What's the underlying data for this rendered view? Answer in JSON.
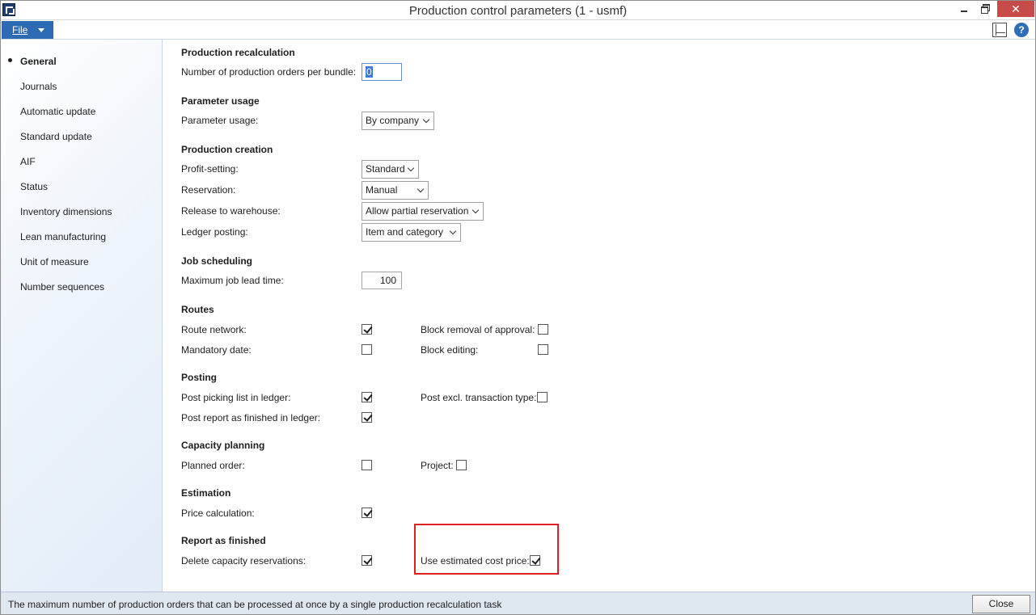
{
  "window": {
    "title": "Production control parameters (1 - usmf)",
    "close_glyph": "✕"
  },
  "menu": {
    "file_label": "File",
    "help_glyph": "?"
  },
  "sidebar": {
    "items": [
      {
        "label": "General",
        "active": true
      },
      {
        "label": "Journals"
      },
      {
        "label": "Automatic update"
      },
      {
        "label": "Standard update"
      },
      {
        "label": "AIF"
      },
      {
        "label": "Status"
      },
      {
        "label": "Inventory dimensions"
      },
      {
        "label": "Lean manufacturing"
      },
      {
        "label": "Unit of measure"
      },
      {
        "label": "Number sequences"
      }
    ]
  },
  "sections": {
    "recalc": {
      "title": "Production recalculation",
      "orders_per_bundle_label": "Number of production orders per bundle:",
      "orders_per_bundle_value": "0"
    },
    "param_usage": {
      "title": "Parameter usage",
      "label": "Parameter usage:",
      "value": "By company"
    },
    "creation": {
      "title": "Production creation",
      "profit_label": "Profit-setting:",
      "profit_value": "Standard",
      "reservation_label": "Reservation:",
      "reservation_value": "Manual",
      "release_label": "Release to warehouse:",
      "release_value": "Allow partial reservation",
      "ledger_label": "Ledger posting:",
      "ledger_value": "Item and category"
    },
    "job": {
      "title": "Job scheduling",
      "lead_time_label": "Maximum job lead time:",
      "lead_time_value": "100"
    },
    "routes": {
      "title": "Routes",
      "route_network_label": "Route network:",
      "route_network_checked": true,
      "mandatory_date_label": "Mandatory date:",
      "mandatory_date_checked": false,
      "block_removal_label": "Block removal of approval:",
      "block_removal_checked": false,
      "block_editing_label": "Block editing:",
      "block_editing_checked": false
    },
    "posting": {
      "title": "Posting",
      "picking_label": "Post picking list in ledger:",
      "picking_checked": true,
      "report_label": "Post report as finished in ledger:",
      "report_checked": true,
      "excl_label": "Post excl. transaction type:",
      "excl_checked": false
    },
    "capacity": {
      "title": "Capacity planning",
      "planned_label": "Planned order:",
      "planned_checked": false,
      "project_label": "Project:",
      "project_checked": false
    },
    "estimation": {
      "title": "Estimation",
      "price_calc_label": "Price calculation:",
      "price_calc_checked": true
    },
    "raf": {
      "title": "Report as finished",
      "delete_cap_label": "Delete capacity reservations:",
      "delete_cap_checked": true,
      "use_est_label": "Use estimated cost price:",
      "use_est_checked": true
    }
  },
  "status": {
    "text": "The maximum number of production orders that can be processed at once by a single production recalculation task",
    "close_label": "Close"
  }
}
